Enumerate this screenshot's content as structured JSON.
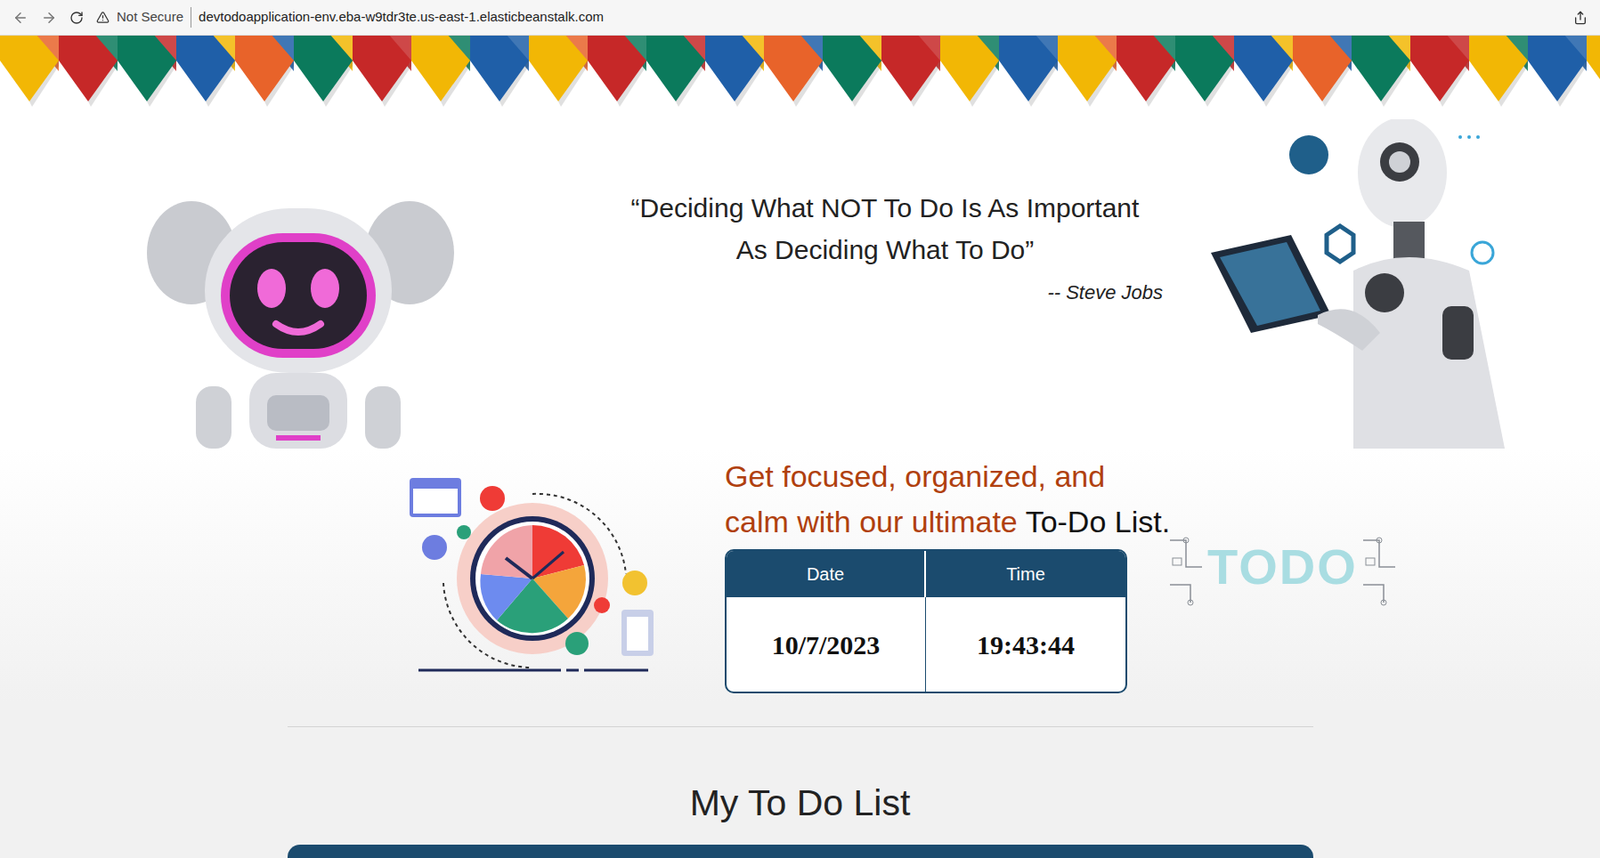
{
  "browser": {
    "security": "Not Secure",
    "url": "devtodoapplication-env.eba-w9tdr3te.us-east-1.elasticbeanstalk.com"
  },
  "quote": {
    "lines": [
      "“Deciding What NOT To Do Is As Important",
      "As Deciding What To Do”"
    ],
    "author": "-- Steve Jobs"
  },
  "tagline": {
    "lines": [
      "Get focused, organized, and",
      "calm with our ultimate"
    ],
    "emphasis": "To-Do List."
  },
  "clock_table": {
    "columns": [
      "Date",
      "Time"
    ],
    "values": [
      "10/7/2023",
      "19:43:44"
    ]
  },
  "todo_logo": "TODO",
  "list": {
    "title": "My To Do List"
  }
}
